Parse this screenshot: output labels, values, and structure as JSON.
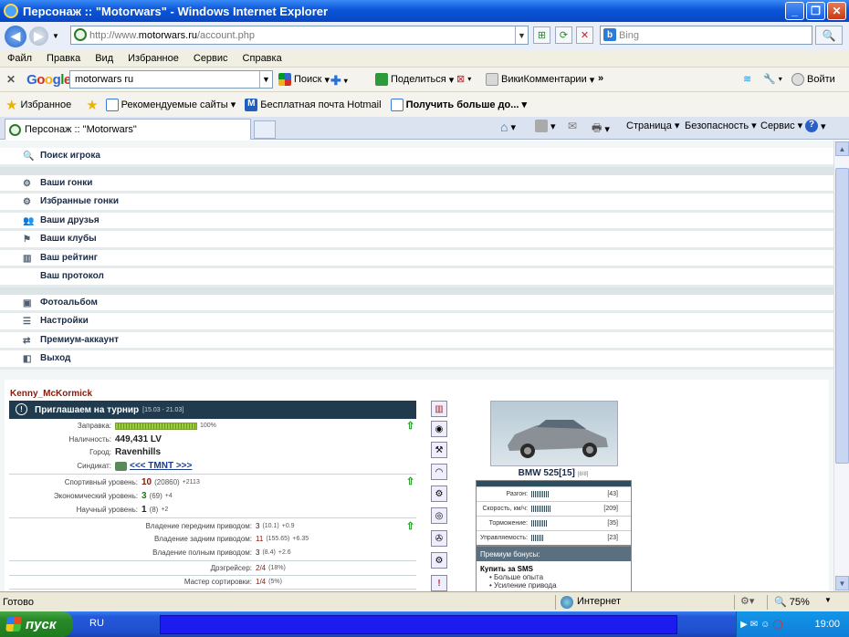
{
  "window": {
    "title": "Персонаж :: \"Motorwars\" - Windows Internet Explorer"
  },
  "address": {
    "prefix": "http://www.",
    "host": "motorwars.ru",
    "path": "/account.php",
    "search_placeholder": "Bing"
  },
  "menubar": {
    "items": [
      "Файл",
      "Правка",
      "Вид",
      "Избранное",
      "Сервис",
      "Справка"
    ]
  },
  "google_toolbar": {
    "query": "motorwars ru",
    "search_label": "Поиск",
    "share_label": "Поделиться",
    "wiki_label": "ВикиКомментарии",
    "login_label": "Войти",
    "more": "»"
  },
  "favorites_bar": {
    "favorites_label": "Избранное",
    "items": [
      "Рекомендуемые сайты",
      "Бесплатная почта Hotmail",
      "Получить больше до..."
    ]
  },
  "tab": {
    "title": "Персонаж :: \"Motorwars\""
  },
  "command_bar": {
    "page": "Страница",
    "safety": "Безопасность",
    "tools": "Сервис"
  },
  "site_menu": [
    {
      "label": "Поиск игрока",
      "icon": "search-icon"
    },
    {
      "label": "Ваши гонки",
      "icon": "wheel-icon"
    },
    {
      "label": "Избранные гонки",
      "icon": "wheel-icon"
    },
    {
      "label": "Ваши друзья",
      "icon": "friends-icon"
    },
    {
      "label": "Ваши клубы",
      "icon": "clubs-icon"
    },
    {
      "label": "Ваш рейтинг",
      "icon": "rating-icon"
    },
    {
      "label": "Ваш протокол",
      "icon": ""
    },
    {
      "label": "Фотоальбом",
      "icon": "photo-icon"
    },
    {
      "label": "Настройки",
      "icon": "settings-icon"
    },
    {
      "label": "Премиум-аккаунт",
      "icon": "premium-icon"
    },
    {
      "label": "Выход",
      "icon": "exit-icon"
    }
  ],
  "profile": {
    "name": "Kenny_McKormick",
    "tournament": {
      "title": "Приглашаем на турнир",
      "dates": "[15.03 - 21.03]"
    },
    "fuel": {
      "label": "Заправка:",
      "percent": 100,
      "text": "100%"
    },
    "cash": {
      "label": "Наличность:",
      "value": "449,431 LV"
    },
    "city": {
      "label": "Город:",
      "value": "Ravenhills"
    },
    "syndicate": {
      "label": "Синдикат:",
      "value": "<<< TMNT >>>"
    },
    "levels": [
      {
        "label": "Спортивный уровень:",
        "value": "10",
        "detail": "(20860)",
        "delta": "+2113"
      },
      {
        "label": "Экономический уровень:",
        "value": "3",
        "detail": "(69)",
        "delta": "+4"
      },
      {
        "label": "Научный уровень:",
        "value": "1",
        "detail": "(8)",
        "delta": "+2"
      }
    ],
    "drives": [
      {
        "label": "Владение передним приводом:",
        "value": "3",
        "detail": "(10.1)",
        "delta": "+0.9"
      },
      {
        "label": "Владение задним приводом:",
        "value": "11",
        "detail": "(155.65)",
        "delta": "+6.35"
      },
      {
        "label": "Владение полным приводом:",
        "value": "3",
        "detail": "(8.4)",
        "delta": "+2.6"
      }
    ],
    "jobs": [
      {
        "label": "Дрэгрейсер:",
        "value": "2/4",
        "detail": "(18%)"
      },
      {
        "label": "Мастер сортировки:",
        "value": "1/4",
        "detail": "(5%)"
      }
    ],
    "car": {
      "name": "BMW 525[15]",
      "slot": "[8/8]",
      "stats": [
        {
          "label": "Разгон:",
          "value": "[43]"
        },
        {
          "label": "Скорость, км/ч:",
          "value": "[209]"
        },
        {
          "label": "Торможение:",
          "value": "[35]"
        },
        {
          "label": "Управляемость:",
          "value": "[23]"
        }
      ]
    },
    "premium": {
      "header": "Премиум бонусы:",
      "title": "Купить за SMS",
      "items": [
        "Больше опыта",
        "Усиление привода"
      ]
    }
  },
  "status": {
    "text": "Готово",
    "zone": "Интернет",
    "zoom": "75%"
  },
  "taskbar": {
    "start": "пуск",
    "lang": "RU",
    "clock": "19:00"
  }
}
